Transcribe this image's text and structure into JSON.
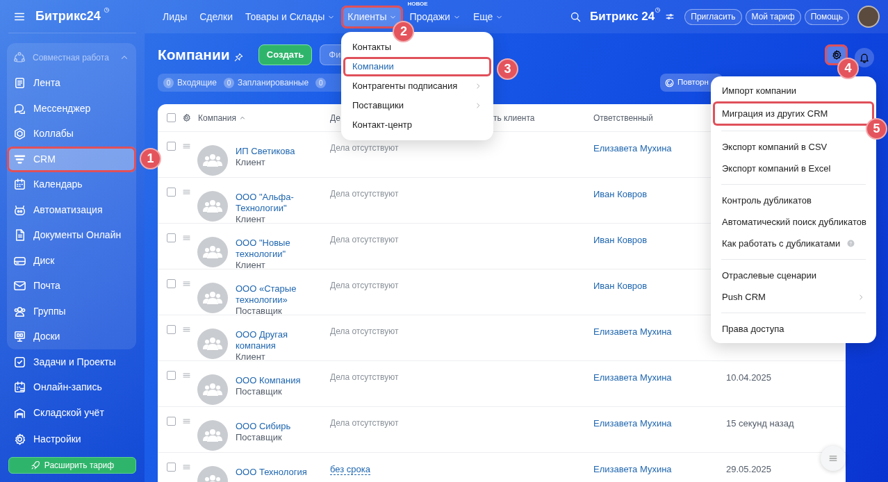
{
  "sidebar": {
    "logo": "Битрикс24",
    "group": {
      "title": "Совместная работа",
      "expanded": true,
      "items": [
        {
          "label": "Лента",
          "selected": false
        },
        {
          "label": "Мессенджер",
          "selected": false
        },
        {
          "label": "Коллабы",
          "selected": false
        },
        {
          "label": "CRM",
          "selected": true,
          "step": "1"
        },
        {
          "label": "Календарь",
          "selected": false
        },
        {
          "label": "Автоматизация",
          "selected": false
        },
        {
          "label": "Документы Онлайн",
          "selected": false
        },
        {
          "label": "Диск",
          "selected": false
        },
        {
          "label": "Почта",
          "selected": false
        },
        {
          "label": "Группы",
          "selected": false
        },
        {
          "label": "Доски",
          "selected": false
        }
      ]
    },
    "items": [
      {
        "label": "Задачи и Проекты",
        "selected": false
      },
      {
        "label": "Онлайн-запись",
        "selected": false
      },
      {
        "label": "Складской учёт",
        "selected": false
      }
    ],
    "settings": "Настройки",
    "upgrade_button": "Расширить тариф"
  },
  "top_nav": {
    "items": [
      {
        "label": "Лиды",
        "dropdown": false,
        "selected": false
      },
      {
        "label": "Сделки",
        "dropdown": false,
        "selected": false
      },
      {
        "label": "Товары и Склады",
        "dropdown": true,
        "selected": false
      },
      {
        "label": "Клиенты",
        "dropdown": true,
        "selected": true,
        "step": "2"
      },
      {
        "label": "Продажи",
        "dropdown": true,
        "selected": false,
        "badge": "НОВОЕ"
      },
      {
        "label": "Еще",
        "dropdown": true,
        "selected": false
      }
    ],
    "logo": "Битрикс 24",
    "buttons": [
      "Пригласить",
      "Мой тариф",
      "Помощь"
    ]
  },
  "page": {
    "title": "Компании",
    "create_button": "Создать",
    "filter_field": "Фи",
    "counters": [
      {
        "count": "0",
        "label": "Входящие"
      },
      {
        "count": "0",
        "label": "Запланированные"
      },
      {
        "count": "0"
      }
    ],
    "repeat_button": "Повторн",
    "settings_step": "4"
  },
  "clients_menu": [
    {
      "label": "Контакты",
      "selected": false,
      "submenu": false
    },
    {
      "label": "Компании",
      "selected": true,
      "submenu": false,
      "step": "3"
    },
    {
      "label": "Контрагенты подписания",
      "selected": false,
      "submenu": true
    },
    {
      "label": "Поставщики",
      "selected": false,
      "submenu": true
    },
    {
      "label": "Контакт-центр",
      "selected": false,
      "submenu": false
    }
  ],
  "settings_menu": [
    [
      {
        "label": "Импорт компании"
      },
      {
        "label": "Миграция из других CRM",
        "step": "5"
      }
    ],
    [
      {
        "label": "Экспорт компаний в CSV"
      },
      {
        "label": "Экспорт компаний в Excel"
      }
    ],
    [
      {
        "label": "Контроль дубликатов"
      },
      {
        "label": "Автоматический поиск дубликатов"
      },
      {
        "label": "Как работать с дубликатами",
        "help": true
      }
    ],
    [
      {
        "label": "Отраслевые сценарии"
      },
      {
        "label": "Push CRM",
        "submenu": true
      }
    ],
    [
      {
        "label": "Права доступа"
      }
    ]
  ],
  "table": {
    "all_checked": false,
    "columns": [
      "Компания",
      "Де",
      "ть клиента",
      "Ответственный"
    ],
    "rows": [
      {
        "name": "ИП Светикова",
        "type": "Клиент",
        "activity": "Дела отсутствуют",
        "responsible": "Елизавета Мухина",
        "checked": false
      },
      {
        "name": "ООО \"Альфа-Технологии\"",
        "type": "Клиент",
        "activity": "Дела отсутствуют",
        "responsible": "Иван Ковров",
        "checked": false
      },
      {
        "name": "ООО \"Новые технологии\"",
        "type": "Клиент",
        "activity": "Дела отсутствуют",
        "responsible": "Иван Ковров",
        "checked": false
      },
      {
        "name": "ООО «Старые технологии»",
        "type": "Поставщик",
        "activity": "Дела отсутствуют",
        "responsible": "Иван Ковров",
        "checked": false
      },
      {
        "name": "ООО Другая компания",
        "type": "Клиент",
        "activity": "Дела отсутствуют",
        "responsible": "Елизавета Мухина",
        "checked": false
      },
      {
        "name": "ООО Компания",
        "type": "Поставщик",
        "activity": "Дела отсутствуют",
        "responsible": "Елизавета Мухина",
        "date": "10.04.2025",
        "checked": false
      },
      {
        "name": "ООО Сибирь",
        "type": "Поставщик",
        "activity": "Дела отсутствуют",
        "responsible": "Елизавета Мухина",
        "date": "15 секунд назад",
        "checked": false
      },
      {
        "name": "ООО Технология",
        "activity": "без срока",
        "kind": "deadline",
        "responsible": "Елизавета Мухина",
        "date": "29.05.2025",
        "checked": false
      }
    ]
  }
}
